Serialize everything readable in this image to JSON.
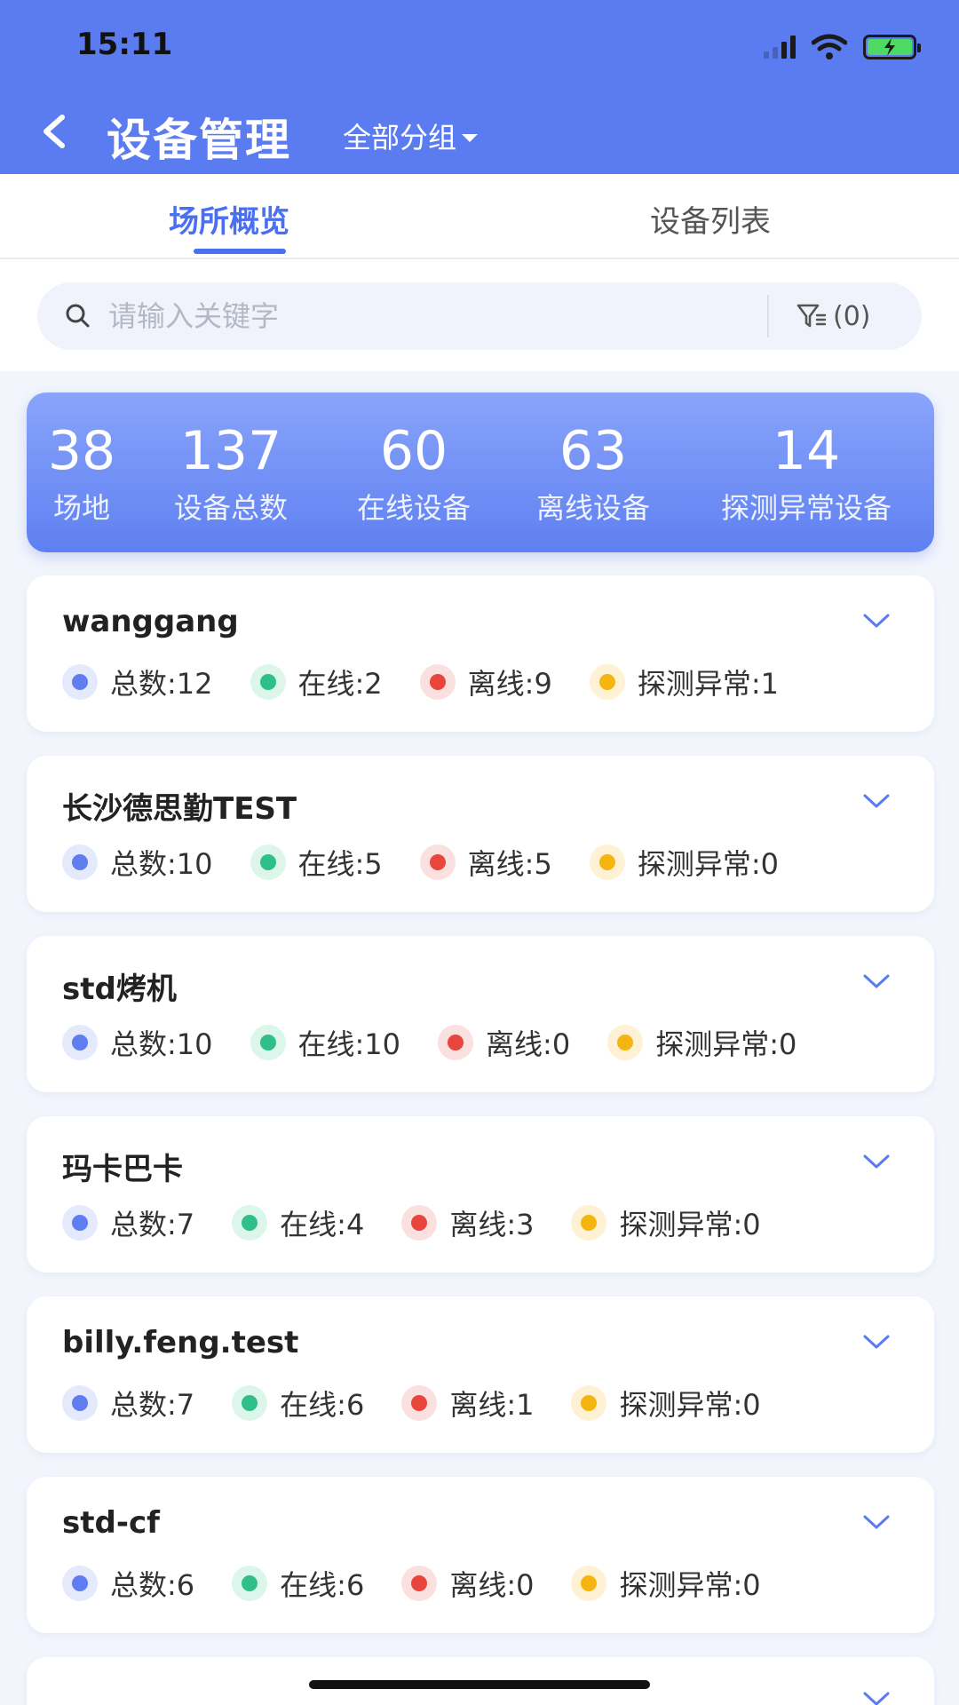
{
  "status_bar": {
    "time": "15:11"
  },
  "header": {
    "title": "设备管理",
    "group_select": "全部分组"
  },
  "tabs": [
    {
      "label": "场所概览"
    },
    {
      "label": "设备列表"
    }
  ],
  "search": {
    "placeholder": "请输入关键字",
    "filter_label": "(0)"
  },
  "summary": [
    {
      "value": "38",
      "label": "场地"
    },
    {
      "value": "137",
      "label": "设备总数"
    },
    {
      "value": "60",
      "label": "在线设备"
    },
    {
      "value": "63",
      "label": "离线设备"
    },
    {
      "value": "14",
      "label": "探测异常设备"
    }
  ],
  "sites": [
    {
      "name": "wanggang",
      "total": "总数:12",
      "online": "在线:2",
      "offline": "离线:9",
      "abnormal": "探测异常:1"
    },
    {
      "name": "长沙德思勤TEST",
      "total": "总数:10",
      "online": "在线:5",
      "offline": "离线:5",
      "abnormal": "探测异常:0"
    },
    {
      "name": "std烤机",
      "total": "总数:10",
      "online": "在线:10",
      "offline": "离线:0",
      "abnormal": "探测异常:0"
    },
    {
      "name": "玛卡巴卡",
      "total": "总数:7",
      "online": "在线:4",
      "offline": "离线:3",
      "abnormal": "探测异常:0"
    },
    {
      "name": "billy.feng.test",
      "total": "总数:7",
      "online": "在线:6",
      "offline": "离线:1",
      "abnormal": "探测异常:0"
    },
    {
      "name": "std-cf",
      "total": "总数:6",
      "online": "在线:6",
      "offline": "离线:0",
      "abnormal": "探测异常:0"
    }
  ],
  "colors": {
    "header": "#5b7cf0",
    "accent": "#4a6ff0",
    "total_dot": "#5f7df0",
    "online_dot": "#2fc08a",
    "offline_dot": "#e8453c",
    "abnormal_dot": "#f5b511"
  }
}
